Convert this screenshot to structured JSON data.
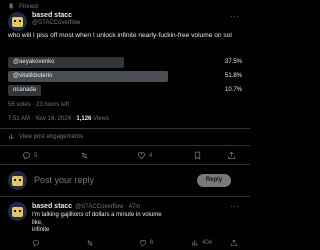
{
  "pinned_label": "Pinned",
  "author": {
    "name": "based stacc",
    "handle": "@STACCoverflow"
  },
  "tweet_text": "who will I piss off most when I unlock infinite nearly-fuckin-free volume on sol",
  "poll": {
    "options": [
      {
        "label": "@aeyakovenko",
        "percent": "37.5%",
        "value": 37.5,
        "winner": false
      },
      {
        "label": "@vitalikbuterin",
        "percent": "51.8%",
        "value": 51.8,
        "winner": true
      },
      {
        "label": "ocanada",
        "percent": "10.7%",
        "value": 10.7,
        "winner": false
      }
    ],
    "summary": "56 votes · 23 hours left"
  },
  "timestamp": "7:51 AM · Nov 16, 2024 · ",
  "views": "1,126",
  "views_label": " Views",
  "engagements_label": "View post engagements",
  "actions": {
    "replies": "5",
    "retweets": "",
    "likes": "4",
    "bookmarks": ""
  },
  "reply_box": {
    "placeholder": "Post your reply",
    "button": "Reply"
  },
  "reply": {
    "name": "based stacc",
    "handle": "@STACCoverflow · 47m",
    "text_line1": "I'm talking gajillions of dollars a minute in volume",
    "text_line2": "like,",
    "text_line3": "infinite",
    "actions": {
      "replies": "",
      "retweets": "",
      "likes": "6",
      "views": "404"
    }
  }
}
